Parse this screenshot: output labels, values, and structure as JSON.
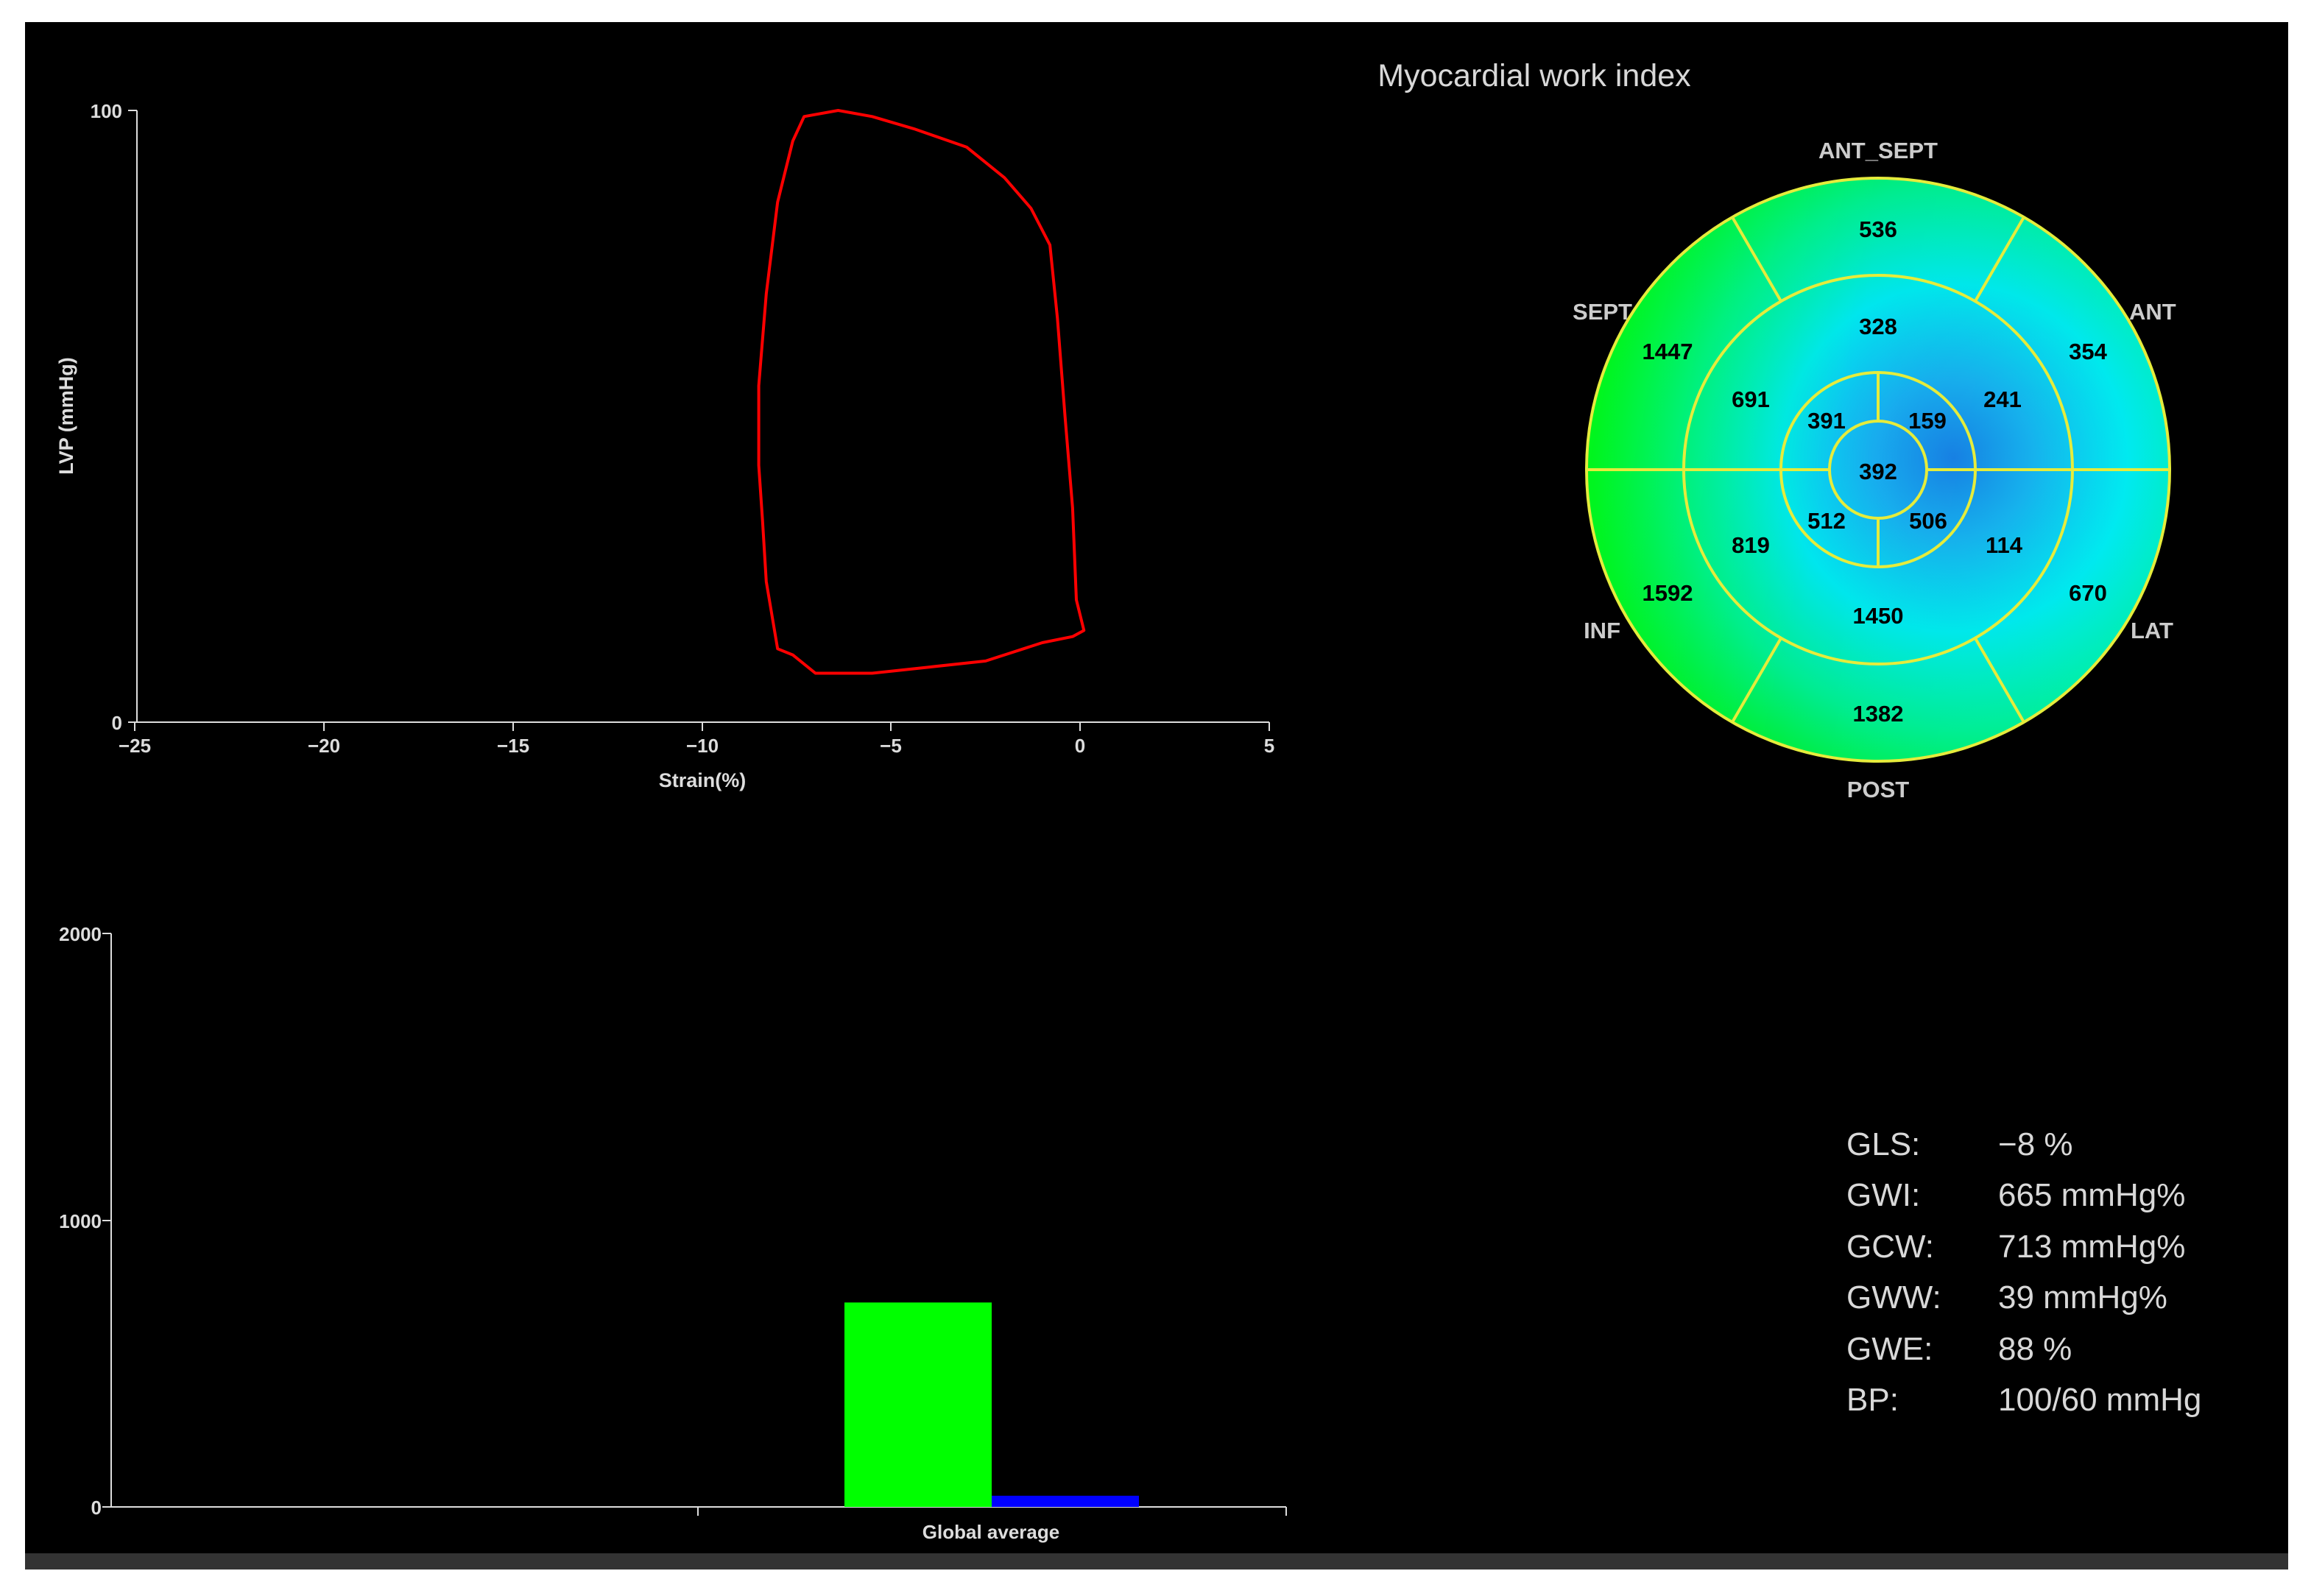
{
  "title": "Myocardial work index",
  "loop_chart": {
    "xlabel": "Strain(%)",
    "ylabel": "LVP (mmHg)",
    "x_ticks": [
      "−25",
      "−20",
      "−15",
      "−10",
      "−5",
      "0",
      "5"
    ],
    "y_ticks": [
      "100",
      "0"
    ]
  },
  "bullseye": {
    "walls": {
      "ant_sept": "ANT_SEPT",
      "ant": "ANT",
      "lat": "LAT",
      "post": "POST",
      "inf": "INF",
      "sept": "SEPT"
    },
    "segments": {
      "basal_ant_sept": "536",
      "basal_ant": "354",
      "basal_lat": "670",
      "basal_post": "1382",
      "basal_inf": "1592",
      "basal_sept": "1447",
      "mid_ant_sept": "328",
      "mid_ant": "241",
      "mid_lat": "114",
      "mid_post": "1450",
      "mid_inf": "819",
      "mid_sept": "691",
      "apical_ant": "391",
      "apical_lat": "159",
      "apical_post": "506",
      "apical_sept": "512",
      "apex": "392"
    },
    "colors": {
      "ring": "#e5ec3c",
      "high": "#00ee22",
      "low": "#18aaf0"
    }
  },
  "bar_chart": {
    "y_ticks": [
      "2000",
      "1000",
      "0"
    ],
    "category_label": "Global average"
  },
  "metrics": {
    "gls": {
      "key": "GLS:",
      "value": "−8 %"
    },
    "gwi": {
      "key": "GWI:",
      "value": "665 mmHg%"
    },
    "gcw": {
      "key": "GCW:",
      "value": "713 mmHg%"
    },
    "gww": {
      "key": "GWW:",
      "value": "39 mmHg%"
    },
    "gwe": {
      "key": "GWE:",
      "value": "88 %"
    },
    "bp": {
      "key": "BP:",
      "value": "100/60 mmHg"
    }
  },
  "chart_data": [
    {
      "type": "line",
      "title": "",
      "xlabel": "Strain(%)",
      "ylabel": "LVP (mmHg)",
      "xlim": [
        -25,
        5
      ],
      "ylim": [
        0,
        100
      ],
      "grid": false,
      "series": [
        {
          "color": "#ff0000",
          "closed": true,
          "x": [
            -6.4,
            -7.3,
            -7.6,
            -8.0,
            -8.3,
            -8.5,
            -8.5,
            -8.4,
            -8.3,
            -8.0,
            -7.6,
            -7.0,
            -6.5,
            -5.5,
            -4.0,
            -2.5,
            -2.0,
            -1.5,
            -1.0,
            -0.2,
            0.1,
            -0.1,
            -0.2,
            -0.4,
            -0.6,
            -0.8,
            -1.3,
            -2.0,
            -3.0,
            -4.4,
            -5.5
          ],
          "y": [
            100,
            99,
            95,
            85,
            70,
            55,
            42,
            33,
            23,
            12,
            11,
            8,
            8,
            8,
            9,
            10,
            11,
            12,
            13,
            14,
            15,
            20,
            35,
            50,
            66,
            78,
            84,
            89,
            94,
            97,
            99
          ]
        }
      ]
    },
    {
      "type": "bar",
      "title": "",
      "categories": [
        "Global average"
      ],
      "ylim": [
        0,
        2000
      ],
      "series": [
        {
          "color": "#00ff00",
          "values": [
            713
          ]
        },
        {
          "color": "#0000ff",
          "values": [
            39
          ]
        }
      ]
    }
  ]
}
